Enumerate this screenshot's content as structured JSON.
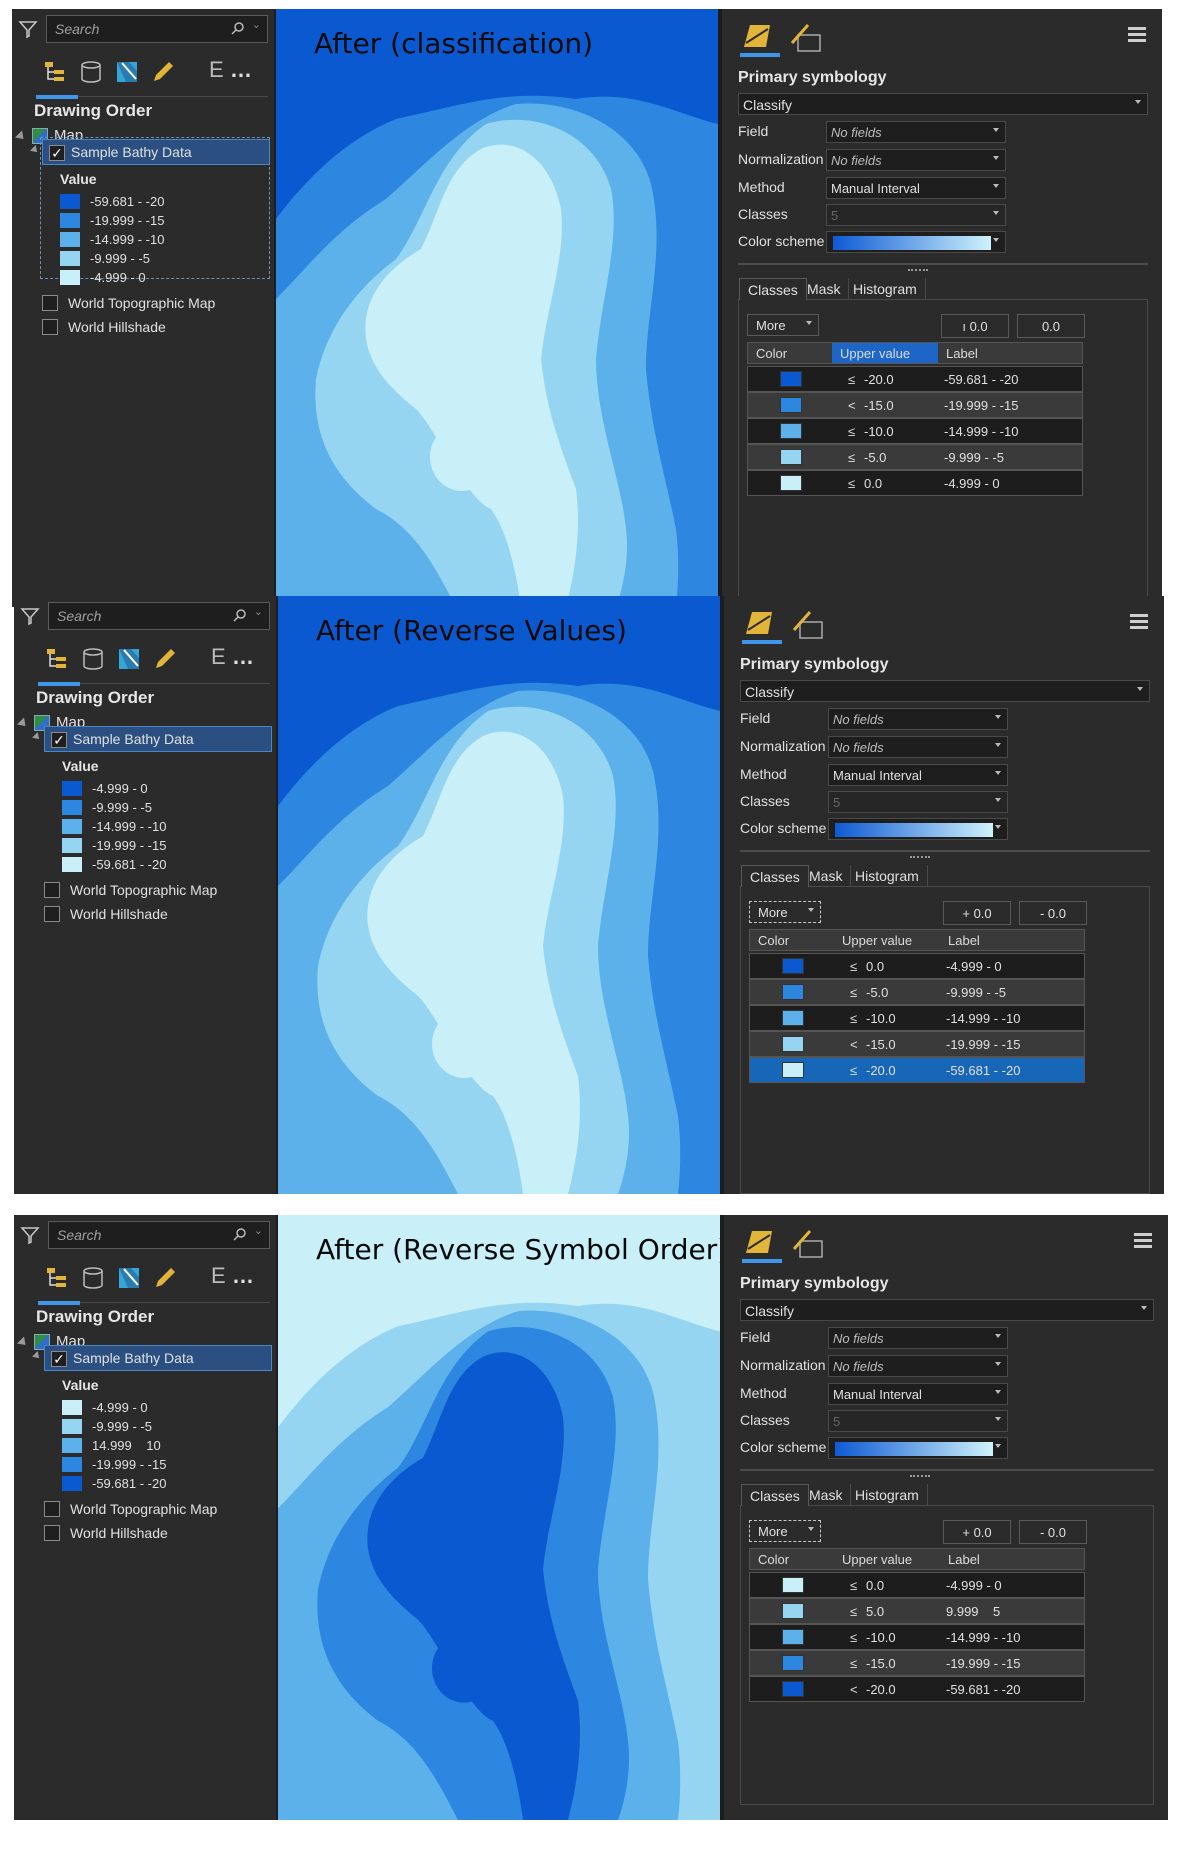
{
  "panels": [
    {
      "map_title": "After (classification)",
      "contents": {
        "search_placeholder": "Search",
        "drawing_order": "Drawing Order",
        "map_label": "Map",
        "layer_label": "Sample Bathy Data",
        "value_header": "Value",
        "legend": [
          {
            "label": "-59.681 - -20",
            "color": "#0b59d0"
          },
          {
            "label": "-19.999 - -15",
            "color": "#2d86e0"
          },
          {
            "label": "-14.999 - -10",
            "color": "#5cb1ea"
          },
          {
            "label": "-9.999 - -5",
            "color": "#95d5f2"
          },
          {
            "label": "-4.999 - 0",
            "color": "#c9eff8"
          }
        ],
        "other_layers": [
          "World Topographic Map",
          "World Hillshade"
        ]
      },
      "symbology": {
        "title": "Primary symbology",
        "renderer": "Classify",
        "field_label": "Field",
        "field_value": "No fields",
        "norm_label": "Normalization",
        "norm_value": "No fields",
        "method_label": "Method",
        "method_value": "Manual Interval",
        "classes_label": "Classes",
        "classes_value": "5",
        "scheme_label": "Color scheme",
        "tabs": [
          "Classes",
          "Mask",
          "Histogram"
        ],
        "more_label": "More",
        "btn_left": "ı 0.0",
        "btn_right": "0.0",
        "col_color": "Color",
        "col_upper": "Upper value",
        "col_label": "Label",
        "rows": [
          {
            "le": "≤",
            "upper": "-20.0",
            "label": "-59.681 - -20",
            "color": "#0b59d0"
          },
          {
            "le": "<",
            "upper": "-15.0",
            "label": "-19.999 - -15",
            "color": "#2d86e0"
          },
          {
            "le": "≤",
            "upper": "-10.0",
            "label": "-14.999 - -10",
            "color": "#5cb1ea"
          },
          {
            "le": "≤",
            "upper": "-5.0",
            "label": "-9.999 - -5",
            "color": "#95d5f2"
          },
          {
            "le": "≤",
            "upper": "0.0",
            "label": "-4.999 - 0",
            "color": "#c9eff8"
          }
        ]
      }
    },
    {
      "map_title": "After (Reverse Values)",
      "contents": {
        "search_placeholder": "Search",
        "drawing_order": "Drawing Order",
        "map_label": "Map",
        "layer_label": "Sample Bathy Data",
        "value_header": "Value",
        "legend": [
          {
            "label": "-4.999 - 0",
            "color": "#0b59d0"
          },
          {
            "label": "-9.999 - -5",
            "color": "#2d86e0"
          },
          {
            "label": "-14.999 - -10",
            "color": "#5cb1ea"
          },
          {
            "label": "-19.999 - -15",
            "color": "#95d5f2"
          },
          {
            "label": "-59.681 - -20",
            "color": "#c9eff8"
          }
        ],
        "other_layers": [
          "World Topographic Map",
          "World Hillshade"
        ]
      },
      "symbology": {
        "title": "Primary symbology",
        "renderer": "Classify",
        "field_label": "Field",
        "field_value": "No fields",
        "norm_label": "Normalization",
        "norm_value": "No fields",
        "method_label": "Method",
        "method_value": "Manual Interval",
        "classes_label": "Classes",
        "classes_value": "5",
        "scheme_label": "Color scheme",
        "tabs": [
          "Classes",
          "Mask",
          "Histogram"
        ],
        "more_label": "More",
        "btn_left": "+ 0.0",
        "btn_right": "- 0.0",
        "col_color": "Color",
        "col_upper": "Upper value",
        "col_label": "Label",
        "rows": [
          {
            "le": "≤",
            "upper": "0.0",
            "label": "-4.999 - 0",
            "color": "#0b59d0"
          },
          {
            "le": "≤",
            "upper": "-5.0",
            "label": "-9.999 - -5",
            "color": "#2d86e0"
          },
          {
            "le": "≤",
            "upper": "-10.0",
            "label": "-14.999 - -10",
            "color": "#5cb1ea"
          },
          {
            "le": "<",
            "upper": "-15.0",
            "label": "-19.999 - -15",
            "color": "#95d5f2"
          },
          {
            "le": "≤",
            "upper": "-20.0",
            "label": "-59.681 - -20",
            "color": "#c9eff8"
          }
        ]
      }
    },
    {
      "map_title": "After (Reverse Symbol Order)",
      "contents": {
        "search_placeholder": "Search",
        "drawing_order": "Drawing Order",
        "map_label": "Map",
        "layer_label": "Sample Bathy Data",
        "value_header": "Value",
        "legend": [
          {
            "label": "-4.999 - 0",
            "color": "#c9eff8"
          },
          {
            "label": "-9.999 - -5",
            "color": "#95d5f2"
          },
          {
            "label": "14.999    10",
            "color": "#5cb1ea"
          },
          {
            "label": "-19.999 - -15",
            "color": "#2d86e0"
          },
          {
            "label": "-59.681 - -20",
            "color": "#0b59d0"
          }
        ],
        "other_layers": [
          "World Topographic Map",
          "World Hillshade"
        ]
      },
      "symbology": {
        "title": "Primary symbology",
        "renderer": "Classify",
        "field_label": "Field",
        "field_value": "No fields",
        "norm_label": "Normalization",
        "norm_value": "No fields",
        "method_label": "Method",
        "method_value": "Manual Interval",
        "classes_label": "Classes",
        "classes_value": "5",
        "scheme_label": "Color scheme",
        "tabs": [
          "Classes",
          "Mask",
          "Histogram"
        ],
        "more_label": "More",
        "btn_left": "+ 0.0",
        "btn_right": "- 0.0",
        "col_color": "Color",
        "col_upper": "Upper value",
        "col_label": "Label",
        "rows": [
          {
            "le": "≤",
            "upper": "0.0",
            "label": "-4.999 - 0",
            "color": "#c9eff8"
          },
          {
            "le": "≤",
            "upper": "5.0",
            "label": "9.999    5",
            "color": "#95d5f2"
          },
          {
            "le": "≤",
            "upper": "-10.0",
            "label": "-14.999 - -10",
            "color": "#5cb1ea"
          },
          {
            "le": "≤",
            "upper": "-15.0",
            "label": "-19.999 - -15",
            "color": "#2d86e0"
          },
          {
            "le": "<",
            "upper": "-20.0",
            "label": "-59.681 - -20",
            "color": "#0b59d0"
          }
        ]
      }
    }
  ],
  "colors": {
    "class1": "#0b59d0",
    "class2": "#2d86e0",
    "class3": "#5cb1ea",
    "class4": "#95d5f2",
    "class5": "#c9eff8",
    "accent": "#3f95ea",
    "selection": "#2a4f80"
  },
  "icons": [
    "filter-icon",
    "search-icon",
    "list-by-drawing-order-icon",
    "list-by-source-icon",
    "list-by-selection-icon",
    "list-by-editing-icon",
    "more-options-icon",
    "primary-symbology-tab-icon",
    "vary-symbology-tab-icon",
    "menu-icon",
    "map-icon"
  ]
}
